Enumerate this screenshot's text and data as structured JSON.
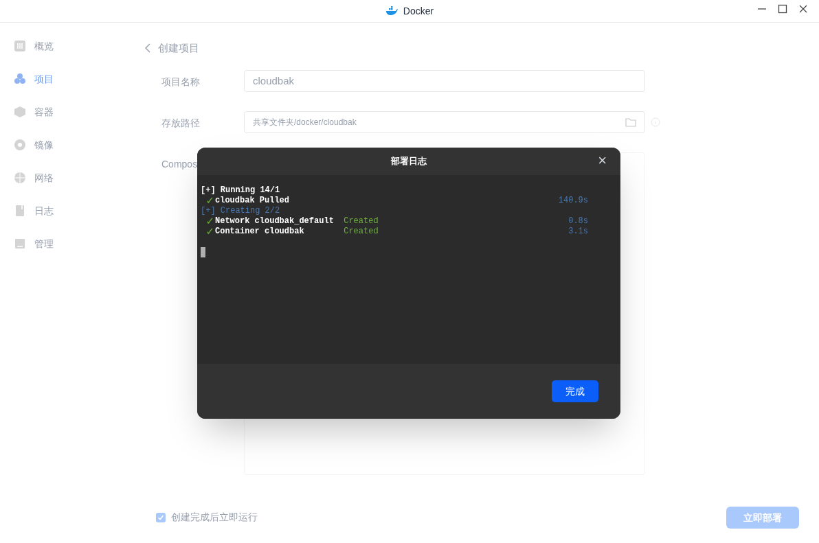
{
  "window": {
    "title": "Docker"
  },
  "sidebar": {
    "items": [
      {
        "label": "概览",
        "selected": false
      },
      {
        "label": "项目",
        "selected": true
      },
      {
        "label": "容器",
        "selected": false
      },
      {
        "label": "镜像",
        "selected": false
      },
      {
        "label": "网络",
        "selected": false
      },
      {
        "label": "日志",
        "selected": false
      },
      {
        "label": "管理",
        "selected": false
      }
    ]
  },
  "page": {
    "title": "创建项目",
    "fields": [
      {
        "kind": "text",
        "label": "项目名称",
        "value": "cloudbak"
      },
      {
        "kind": "path",
        "label": "存放路径",
        "value": "共享文件夹/docker/cloudbak"
      },
      {
        "kind": "editor",
        "label": "Compos"
      }
    ],
    "run_after_create": {
      "label": "创建完成后立即运行",
      "checked": true
    },
    "deploy_button": "立即部署"
  },
  "dialog": {
    "title": "部署日志",
    "close": "×",
    "lines": [
      {
        "kind": "heading",
        "text": "[+] Running 14/1",
        "active": false
      },
      {
        "kind": "step",
        "mark": "✓",
        "text": "cloudbak Pulled",
        "time": "140.9s"
      },
      {
        "kind": "heading",
        "text": "[+] Creating 2/2",
        "active": true
      },
      {
        "kind": "step",
        "mark": "✓",
        "text": "Network cloudbak_default",
        "status": "Created",
        "time": "0.8s"
      },
      {
        "kind": "step",
        "mark": "✓",
        "text": "Container cloudbak",
        "status": "Created",
        "time": "3.1s"
      }
    ],
    "done_button": "完成"
  }
}
